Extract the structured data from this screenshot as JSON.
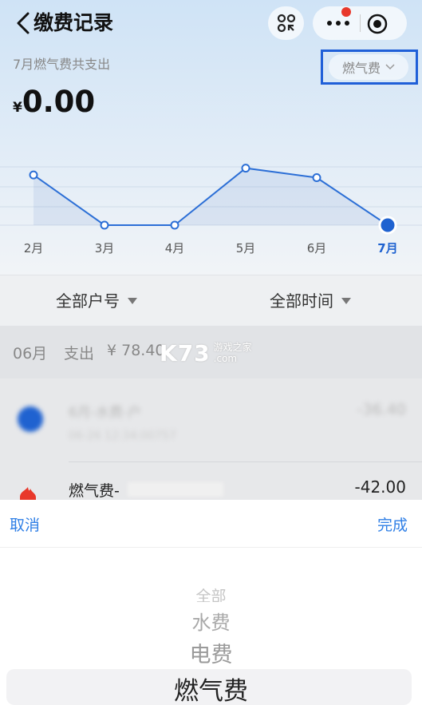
{
  "header": {
    "title": "缴费记录"
  },
  "summary": {
    "label": "7月燃气费共支出",
    "currency": "¥",
    "amount": "0.00",
    "filter": "燃气费"
  },
  "chart_data": {
    "type": "line",
    "categories": [
      "2月",
      "3月",
      "4月",
      "5月",
      "6月",
      "7月"
    ],
    "values": [
      37,
      0,
      0,
      42,
      35,
      0
    ],
    "highlighted_index": 5,
    "ylim": [
      0,
      60
    ],
    "grid": true,
    "line_color": "#2c6fd6",
    "highlight_color": "#1f62d0"
  },
  "selectors": {
    "account": "全部户号",
    "time": "全部时间"
  },
  "month_group": {
    "month": "06月",
    "type": "支出",
    "amount": "¥ 78.40"
  },
  "watermark": {
    "main": "K73",
    "line1": "游戏之家",
    "line2": ".com"
  },
  "records": [
    {
      "title": "6月-水费-户",
      "subtitle": "06-26 12:34:00757",
      "amount": "-36.40",
      "icon": "water-icon",
      "color": "#1f62d0"
    },
    {
      "title": "燃气费-",
      "amount": "-42.00",
      "icon": "flame-icon",
      "color": "#e8382b"
    }
  ],
  "picker": {
    "cancel": "取消",
    "done": "完成",
    "options": [
      "全部",
      "水费",
      "电费",
      "燃气费"
    ]
  },
  "colors": {
    "accent": "#2f7fe6",
    "highlight_box": "#1f5fd8"
  }
}
